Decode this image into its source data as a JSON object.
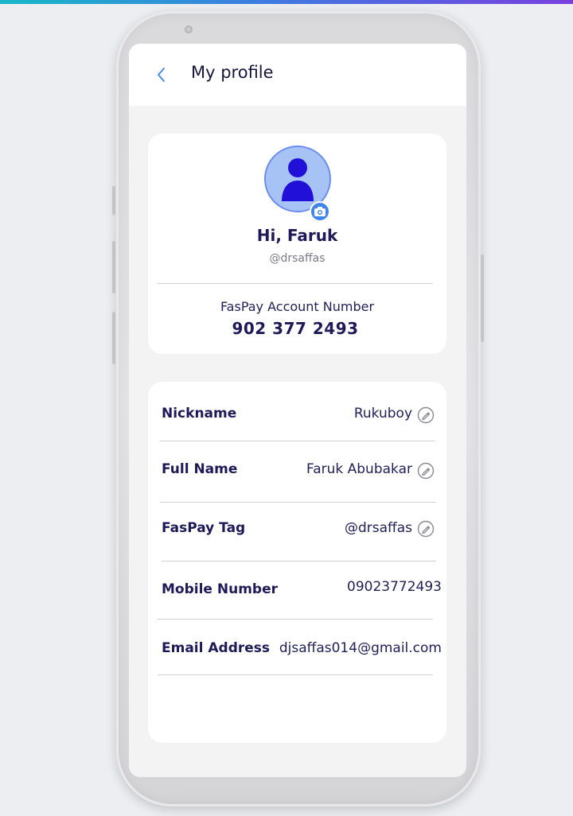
{
  "header": {
    "title": "My profile"
  },
  "profile": {
    "greeting": "Hi, Faruk",
    "handle": "@drsaffas",
    "account_label": "FasPay Account Number",
    "account_number": "902 377 2493"
  },
  "details": {
    "rows": [
      {
        "label": "Nickname",
        "value": "Rukuboy",
        "editable": true
      },
      {
        "label": "Full Name",
        "value": "Faruk Abubakar",
        "editable": true
      },
      {
        "label": "FasPay Tag",
        "value": "@drsaffas",
        "editable": true
      },
      {
        "label": "Mobile Number",
        "value": "09023772493",
        "editable": false
      },
      {
        "label": "Email Address",
        "value": "djsaffas014@gmail.com",
        "editable": false
      }
    ]
  },
  "icons": {
    "back": "chevron-left-icon",
    "avatar": "user-icon",
    "camera": "camera-icon",
    "edit": "edit-pencil-icon"
  },
  "colors": {
    "accent": "#3f86ec",
    "text_primary": "#1e1a5a",
    "avatar_bg": "#a7c3f6",
    "avatar_figure": "#2010d8"
  }
}
